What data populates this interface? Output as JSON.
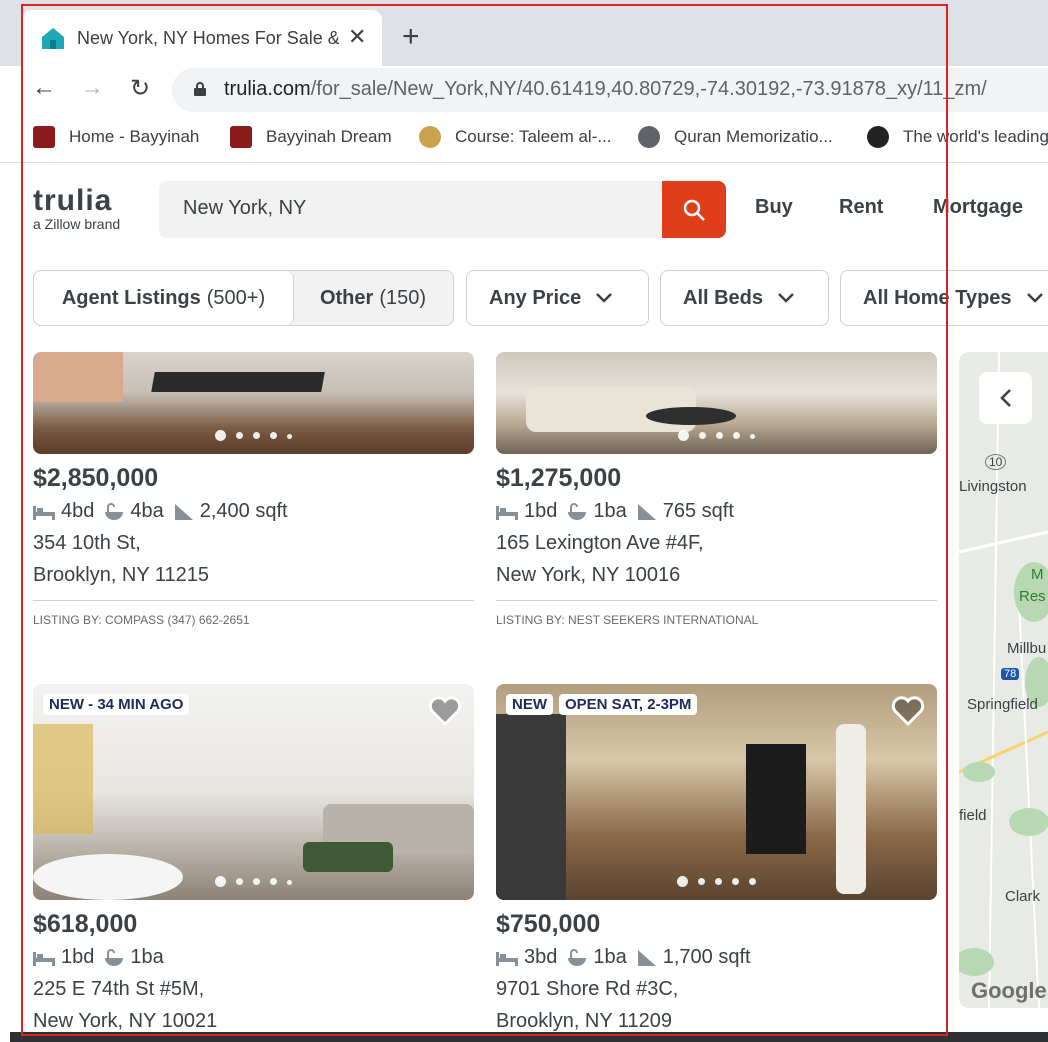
{
  "browser": {
    "tab_title": "New York, NY Homes For Sale & Real Estate",
    "url_host": "trulia.com",
    "url_path": "/for_sale/New_York,NY/40.61419,40.80729,-74.30192,-73.91878_xy/11_zm/",
    "bookmarks": [
      {
        "label": "Home - Bayyinah",
        "icon": "bayyinah-icon"
      },
      {
        "label": "Bayyinah Dream",
        "icon": "bayyinah-icon"
      },
      {
        "label": "Course: Taleem al-...",
        "icon": "course-icon"
      },
      {
        "label": "Quran Memorizatio...",
        "icon": "globe-icon"
      },
      {
        "label": "The world's leading",
        "icon": "github-icon"
      }
    ]
  },
  "header": {
    "logo": "trulia",
    "logo_sub": "a Zillow brand",
    "search_value": "New York, NY",
    "nav": [
      "Buy",
      "Rent",
      "Mortgage"
    ]
  },
  "filters": {
    "agent_label": "Agent Listings",
    "agent_count": "(500+)",
    "other_label": "Other",
    "other_count": "(150)",
    "price": "Any Price",
    "beds": "All Beds",
    "home_types": "All Home Types"
  },
  "listings": [
    {
      "price": "$2,850,000",
      "beds": "4bd",
      "baths": "4ba",
      "sqft": "2,400 sqft",
      "street": "354 10th St,",
      "city": "Brooklyn, NY 11215",
      "listed_by": "LISTING BY: COMPASS (347) 662-2651"
    },
    {
      "price": "$1,275,000",
      "beds": "1bd",
      "baths": "1ba",
      "sqft": "765 sqft",
      "street": "165 Lexington Ave #4F,",
      "city": "New York, NY 10016",
      "listed_by": "LISTING BY: NEST SEEKERS INTERNATIONAL"
    },
    {
      "price": "$618,000",
      "beds": "1bd",
      "baths": "1ba",
      "sqft": "",
      "street": "225 E 74th St #5M,",
      "city": "New York, NY 10021",
      "badges": [
        "NEW - 34 MIN AGO"
      ]
    },
    {
      "price": "$750,000",
      "beds": "3bd",
      "baths": "1ba",
      "sqft": "1,700 sqft",
      "street": "9701 Shore Rd #3C,",
      "city": "Brooklyn, NY 11209",
      "badges": [
        "NEW",
        "OPEN SAT, 2-3PM"
      ]
    }
  ],
  "map": {
    "labels": [
      "10",
      "Livingston",
      "M",
      "Res",
      "Millbu",
      "78",
      "Springfield",
      "field",
      "Clark",
      "Google"
    ]
  },
  "colors": {
    "brand_red": "#e03e1a",
    "text": "#3b4144",
    "badge_text": "#1d2c5a"
  }
}
